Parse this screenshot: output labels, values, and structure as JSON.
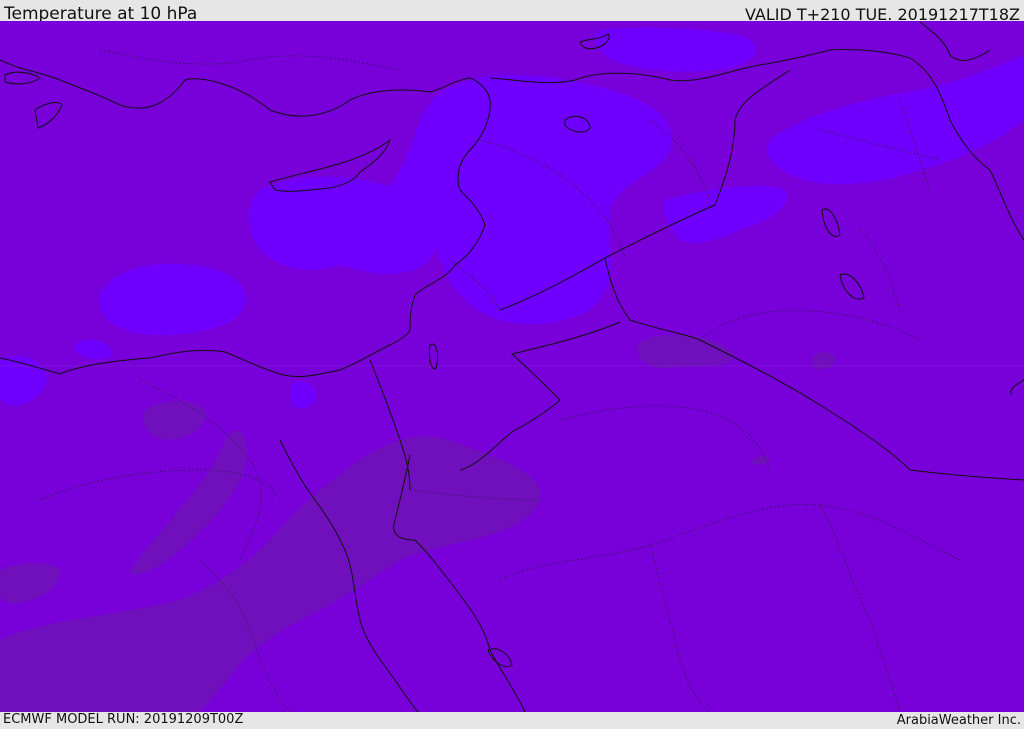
{
  "header": {
    "title": "Temperature at 10 hPa",
    "valid": "VALID T+210 TUE. 20191217T18Z"
  },
  "footer": {
    "model_run": "ECMWF MODEL RUN: 20191209T00Z",
    "credit": "ArabiaWeather Inc."
  },
  "map": {
    "colors": {
      "base_fill": "#7800d8",
      "light_fill": "#7000fe",
      "dark_fill": "#7010bc",
      "border_line": "#111111",
      "province_line": "#3a1a66"
    }
  }
}
